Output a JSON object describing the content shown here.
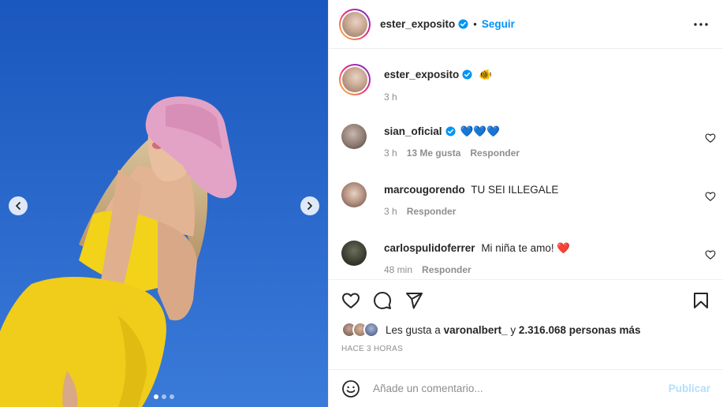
{
  "post": {
    "author": "ester_exposito",
    "follow_label": "Seguir",
    "bullet": "•",
    "caption_emoji": "🐠",
    "caption_time": "3 h",
    "carousel": {
      "total": 3,
      "active": 1
    }
  },
  "comments": [
    {
      "user": "sian_oficial",
      "verified": true,
      "text": "💙💙💙",
      "time": "3 h",
      "likes": "13 Me gusta",
      "reply": "Responder"
    },
    {
      "user": "marcougorendo",
      "verified": false,
      "text": "TU SEI ILLEGALE",
      "time": "3 h",
      "likes": "",
      "reply": "Responder"
    },
    {
      "user": "carlospulidoferrer",
      "verified": false,
      "text": "Mi niña te amo! ❤️",
      "time": "48 min",
      "likes": "",
      "reply": "Responder"
    }
  ],
  "likes": {
    "prefix": "Les gusta a",
    "user": "varonalbert_",
    "middle": "y",
    "count": "2.316.068 personas más"
  },
  "timestamp": "HACE 3 HORAS",
  "composer": {
    "placeholder": "Añade un comentario...",
    "publish_label": "Publicar"
  },
  "colors": {
    "link": "#0095f6",
    "publish_disabled": "#b2dffc",
    "verified": "#0095f6",
    "heart_red": "#ed4956",
    "sky": "#2a6bd0"
  },
  "icons": {
    "prev": "chevron-left-icon",
    "next": "chevron-right-icon",
    "more": "more-horizontal-icon",
    "like": "heart-icon",
    "comment": "comment-icon",
    "share": "paper-plane-icon",
    "save": "bookmark-icon",
    "emoji": "smiley-icon"
  }
}
